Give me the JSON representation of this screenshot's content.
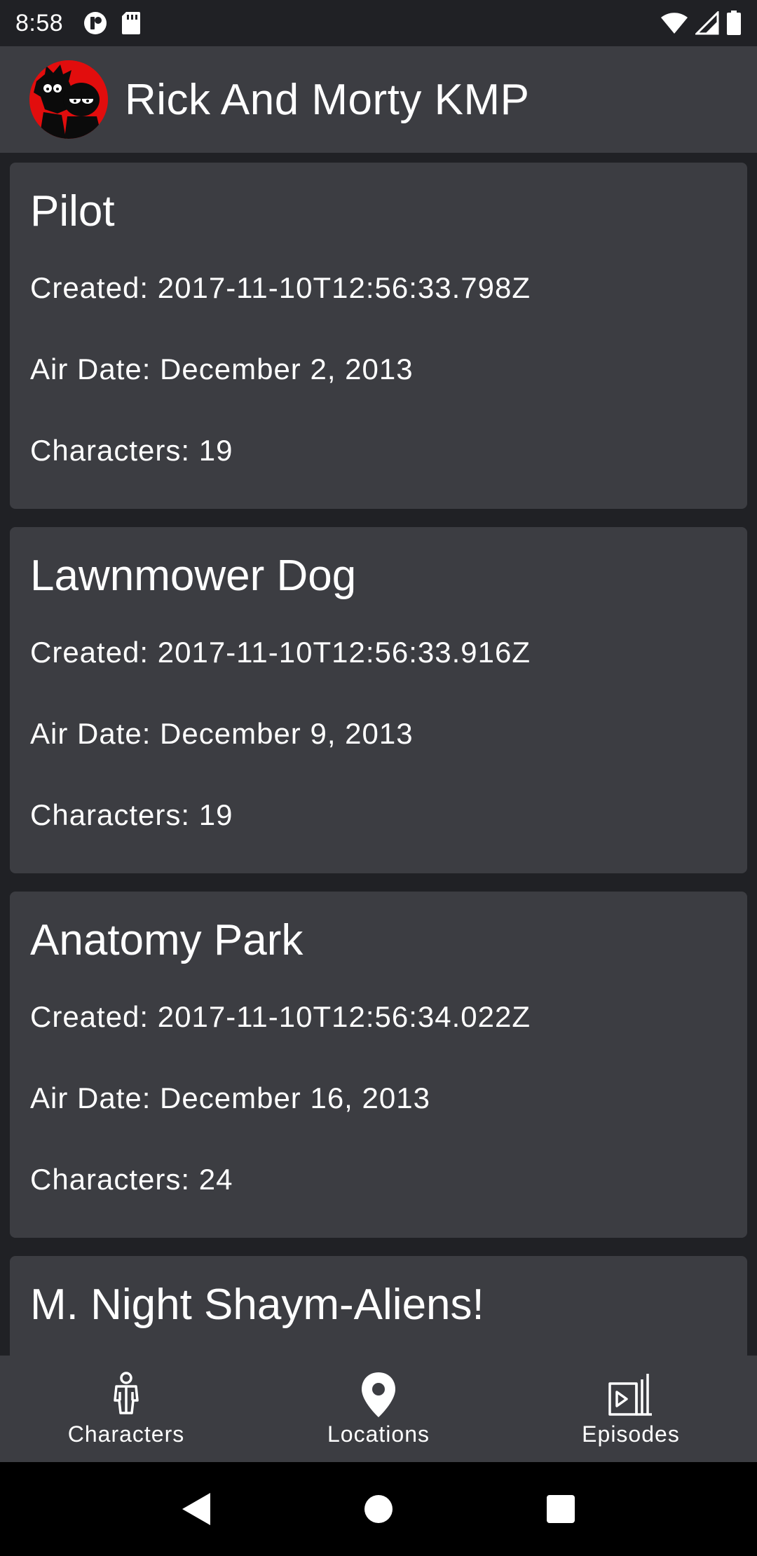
{
  "status_bar": {
    "time": "8:58"
  },
  "app_bar": {
    "title": "Rick And Morty KMP"
  },
  "episodes": [
    {
      "name": "Pilot",
      "created": "Created: 2017-11-10T12:56:33.798Z",
      "air_date": "Air Date: December 2, 2013",
      "characters": "Characters: 19"
    },
    {
      "name": "Lawnmower Dog",
      "created": "Created: 2017-11-10T12:56:33.916Z",
      "air_date": "Air Date: December 9, 2013",
      "characters": "Characters: 19"
    },
    {
      "name": "Anatomy Park",
      "created": "Created: 2017-11-10T12:56:34.022Z",
      "air_date": "Air Date: December 16, 2013",
      "characters": "Characters: 24"
    },
    {
      "name": "M. Night Shaym-Aliens!"
    }
  ],
  "bottom_nav": {
    "items": [
      {
        "label": "Characters",
        "icon": "person-icon"
      },
      {
        "label": "Locations",
        "icon": "location-pin-icon"
      },
      {
        "label": "Episodes",
        "icon": "episodes-icon"
      }
    ]
  },
  "colors": {
    "background": "#202125",
    "surface": "#3c3d42",
    "logo_red": "#e20d0d",
    "text": "#ffffff"
  }
}
